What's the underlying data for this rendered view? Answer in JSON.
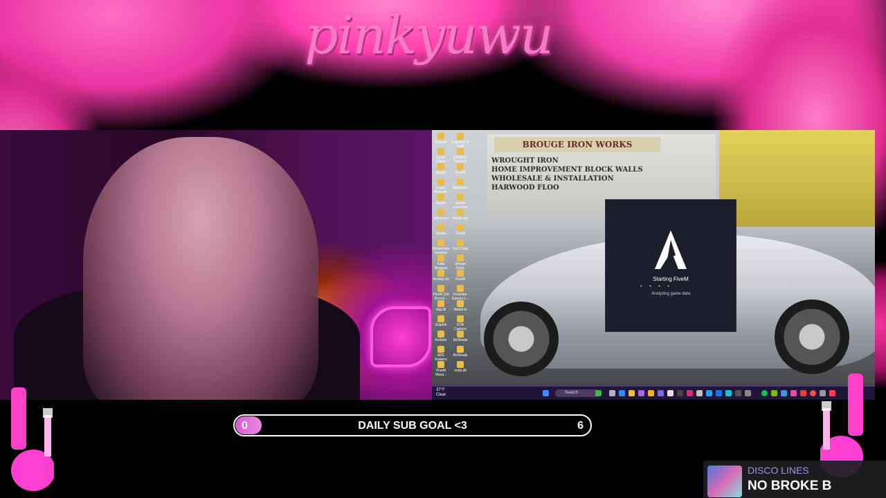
{
  "overlay": {
    "logo_text": "pinkyuwu",
    "accent_color": "#ff3fb0"
  },
  "game": {
    "sign_title": "BROUGE IRON WORKS",
    "sign_lines": [
      "WROUGHT IRON",
      "HOME IMPROVEMENT   BLOCK WALLS",
      "WHOLESALE & INSTALLATION",
      "HARWOOD FLOO"
    ],
    "desktop_icons": [
      "Recycle",
      "Logitech G HUB",
      "Lunar Client",
      "GAMEST Control",
      "Spotify",
      "FiveM",
      "Lunar Browser",
      "Bitwarden",
      "Elgato",
      "Game Launcher",
      "pinkyuwu",
      "RockLogo",
      "Medal",
      "FiveM",
      "Streamlabs Desktop",
      "Golf Chart",
      "Insta Wrapper",
      "Stream Deck",
      "Among Us",
      "FiveM",
      "FiveM Crit Demol...",
      "Rockstar Games L...",
      "dsg.dll",
      "Medal.tv",
      "Dolphin",
      "GTA Capture",
      "Fortnite",
      "ReShade",
      "ARC Raiders",
      "ReShade",
      "FiveM Visua...",
      "nvda.dll"
    ],
    "taskbar": {
      "weather_temp": "37°F",
      "weather_desc": "Clear",
      "search_placeholder": "Search"
    },
    "fivem_dialog": {
      "title": "Starting FiveM",
      "dots": "• • • •",
      "subtitle": "Analyzing game data"
    }
  },
  "sub_goal": {
    "current": "0",
    "title": "DAILY SUB GOAL <3",
    "target": "6",
    "progress_fraction": 0
  },
  "now_playing": {
    "artist": "DISCO LINES",
    "title": "NO BROKE B"
  }
}
